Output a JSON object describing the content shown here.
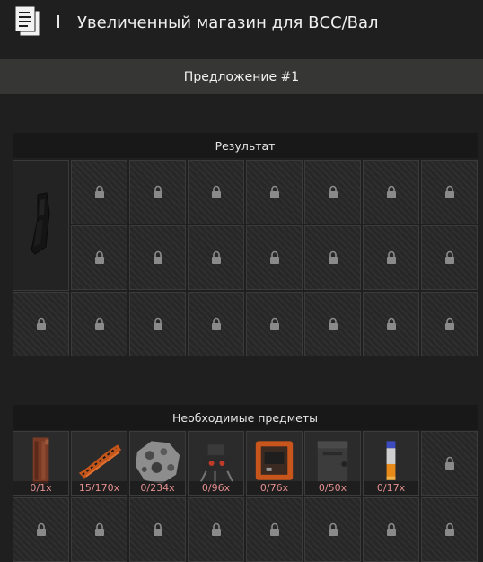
{
  "header": {
    "title": "Увеличенный магазин для ВСС/Вал",
    "icon": "document-icon"
  },
  "offer": {
    "label": "Предложение #1"
  },
  "result": {
    "title": "Результат",
    "item": "magazine-icon",
    "locked_slots": 22
  },
  "required": {
    "title": "Необходимые предметы",
    "items": [
      {
        "icon": "rust-plate-icon",
        "qty": "0/1x"
      },
      {
        "icon": "orange-fiber-icon",
        "qty": "15/170x"
      },
      {
        "icon": "scrap-metal-icon",
        "qty": "0/234x"
      },
      {
        "icon": "circuit-part-icon",
        "qty": "0/96x"
      },
      {
        "icon": "electronic-board-icon",
        "qty": "0/76x"
      },
      {
        "icon": "ammo-box-icon",
        "qty": "0/50x"
      },
      {
        "icon": "flare-tube-icon",
        "qty": "0/17x"
      }
    ]
  },
  "colors": {
    "qty_text": "#e58f8f",
    "background": "#1f1f1f",
    "bar": "#363634"
  }
}
